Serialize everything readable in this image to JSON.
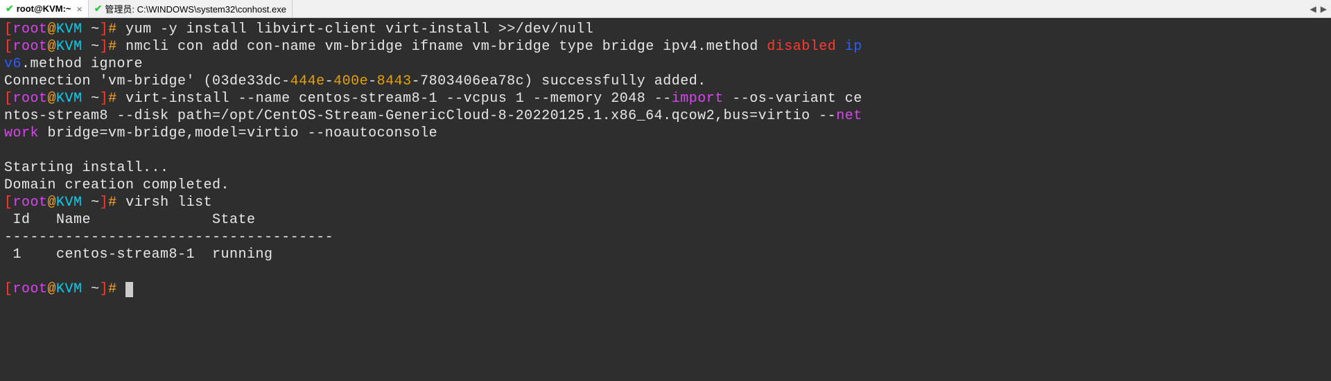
{
  "tabs": [
    {
      "label": "root@KVM:~",
      "active": true
    },
    {
      "label": "管理员: C:\\WINDOWS\\system32\\conhost.exe",
      "active": false
    }
  ],
  "prompt": {
    "lbracket": "[",
    "user": "root",
    "at": "@",
    "host": "KVM",
    "path": " ~",
    "rbracket": "]",
    "hash": "# "
  },
  "cmd1": "yum -y install libvirt-client virt-install >>/dev/null",
  "cmd2_a": "nmcli con add con-name vm-bridge ifname vm-bridge type bridge ipv4.method ",
  "cmd2_disabled": "disabled",
  "cmd2_sp": " ",
  "cmd2_ip": "ip",
  "cmd2_v6": "v6",
  "cmd2_rest": ".method ignore",
  "conn_a": "Connection 'vm-bridge' (03de33dc-",
  "conn_b": "444e",
  "conn_c": "-",
  "conn_d": "400e",
  "conn_e": "-",
  "conn_f": "8443",
  "conn_g": "-7803406ea78c) successfully added.",
  "cmd3_a": "virt-install --name centos-stream8-1 --vcpus 1 --memory 2048 --",
  "cmd3_import": "import",
  "cmd3_b": " --os-variant ce",
  "cmd3_line2a": "ntos-stream8 --disk path=/opt/CentOS-Stream-GenericCloud-8-20220125.1.x86_64.qcow2,bus=virtio --",
  "cmd3_net": "net",
  "cmd3_work": "work",
  "cmd3_line3": " bridge=vm-bridge,model=virtio --noautoconsole",
  "blank": " ",
  "starting": "Starting install...",
  "domain_done": "Domain creation completed.",
  "cmd4": "virsh list",
  "table_header": " Id   Name              State",
  "table_sep": "--------------------------------------",
  "table_row": " 1    centos-stream8-1  running",
  "nav": {
    "left": "◀",
    "right": "▶"
  }
}
